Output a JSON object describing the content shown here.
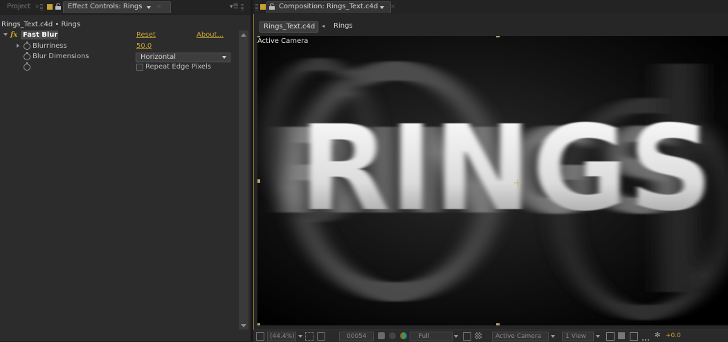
{
  "left_panel": {
    "tabs": {
      "project": "Project",
      "effect_controls": "Effect Controls: Rings"
    },
    "breadcrumb": "Rings_Text.c4d • Rings",
    "effect": {
      "name": "Fast Blur",
      "badge": "fx",
      "reset": "Reset",
      "about": "About...",
      "properties": [
        {
          "label": "Blurriness",
          "value": "50.0"
        },
        {
          "label": "Blur Dimensions",
          "value": "Horizontal"
        },
        {
          "label": "",
          "checkbox_label": "Repeat Edge Pixels",
          "checked": false
        }
      ]
    },
    "panel_menu_icon": "panel-menu-icon"
  },
  "right_panel": {
    "tab": "Composition: Rings_Text.c4d",
    "comp_button": "Rings_Text.c4d",
    "layer_crumb": "Rings",
    "viewer": {
      "camera_label": "Active Camera",
      "render_text": "RINGS"
    },
    "toolbar": {
      "magnification": "(44.4%)",
      "timecode": "00054",
      "resolution": "Full",
      "camera": "Active Camera",
      "view_layout": "1 View",
      "exposure": "+0.0"
    }
  },
  "colors": {
    "accent": "#c5a332",
    "panel_bg": "#2c2c2c",
    "viewer_bg": "#000000"
  }
}
